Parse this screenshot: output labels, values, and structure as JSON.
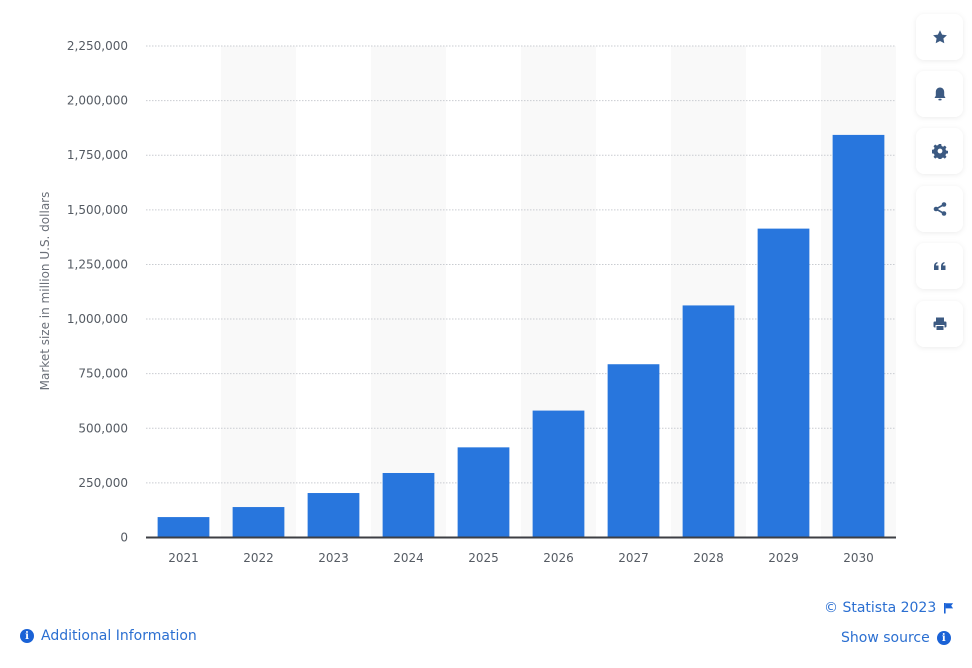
{
  "chart_data": {
    "type": "bar",
    "title": "",
    "xlabel": "",
    "ylabel": "Market size in million U.S. dollars",
    "categories": [
      "2021",
      "2022",
      "2023",
      "2024",
      "2025",
      "2026",
      "2027",
      "2028",
      "2029",
      "2030"
    ],
    "values": [
      93500,
      139400,
      203600,
      295300,
      412700,
      581000,
      793200,
      1062400,
      1414000,
      1843000
    ],
    "ylim": [
      0,
      2250000
    ],
    "yticks": [
      0,
      250000,
      500000,
      750000,
      1000000,
      1250000,
      1500000,
      1750000,
      2000000,
      2250000
    ],
    "ytick_labels": [
      "0",
      "250,000",
      "500,000",
      "750,000",
      "1,000,000",
      "1,250,000",
      "1,500,000",
      "1,750,000",
      "2,000,000",
      "2,250,000"
    ],
    "grid": true,
    "legend": "none",
    "bar_color": "#2876dd",
    "band_color": "#f9f9f9"
  },
  "sidebar": {
    "buttons": [
      {
        "name": "favorite",
        "icon": "star-icon"
      },
      {
        "name": "notification",
        "icon": "bell-icon"
      },
      {
        "name": "settings",
        "icon": "gear-icon"
      },
      {
        "name": "share",
        "icon": "share-icon"
      },
      {
        "name": "cite",
        "icon": "quote-icon"
      },
      {
        "name": "print",
        "icon": "print-icon"
      }
    ]
  },
  "footer": {
    "additional_info": "Additional Information",
    "copyright": "© Statista 2023",
    "show_source": "Show source",
    "info_glyph": "i"
  },
  "colors": {
    "accent": "#2b6fd1",
    "icon": "#3c5a82"
  }
}
